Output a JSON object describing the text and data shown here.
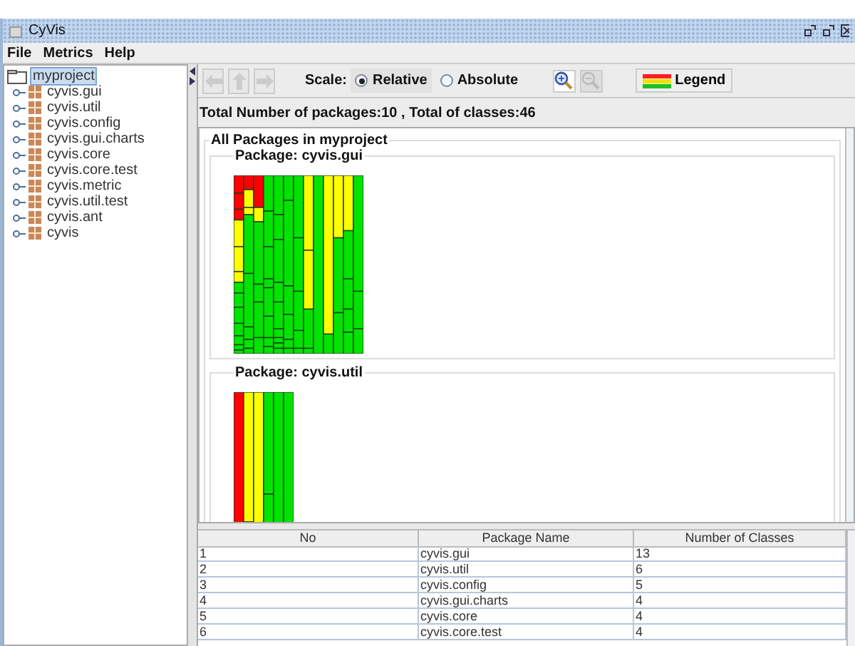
{
  "window": {
    "title": "CyVis"
  },
  "menu": [
    "File",
    "Metrics",
    "Help"
  ],
  "tree": {
    "root": {
      "label": "myproject",
      "selected": true
    },
    "children": [
      {
        "label": "cyvis.gui",
        "selected": false
      },
      {
        "label": "cyvis.util",
        "selected": false
      },
      {
        "label": "cyvis.config",
        "selected": false
      },
      {
        "label": "cyvis.gui.charts",
        "selected": false
      },
      {
        "label": "cyvis.core",
        "selected": false
      },
      {
        "label": "cyvis.core.test",
        "selected": false
      },
      {
        "label": "cyvis.metric",
        "selected": false
      },
      {
        "label": "cyvis.util.test",
        "selected": false
      },
      {
        "label": "cyvis.ant",
        "selected": false
      },
      {
        "label": "cyvis",
        "selected": false
      }
    ]
  },
  "toolbar": {
    "scale_label": "Scale:",
    "scale_options": [
      {
        "label": "Relative",
        "selected": true
      },
      {
        "label": "Absolute",
        "selected": false
      }
    ],
    "legend": "Legend"
  },
  "summary": "Total Number of packages:10 , Total of classes:46",
  "overview": {
    "title": "All Packages in myproject",
    "packages": [
      {
        "title": "Package: cyvis.gui",
        "kind": "treemap"
      },
      {
        "title": "Package: cyvis.util",
        "kind": "treemap"
      }
    ]
  },
  "table": {
    "columns": [
      "No",
      "Package Name",
      "Number of Classes"
    ],
    "rows": [
      [
        "1",
        "cyvis.gui",
        "13"
      ],
      [
        "2",
        "cyvis.util",
        "6"
      ],
      [
        "3",
        "cyvis.config",
        "5"
      ],
      [
        "4",
        "cyvis.gui.charts",
        "4"
      ],
      [
        "5",
        "cyvis.core",
        "4"
      ],
      [
        "6",
        "cyvis.core.test",
        "4"
      ]
    ]
  }
}
